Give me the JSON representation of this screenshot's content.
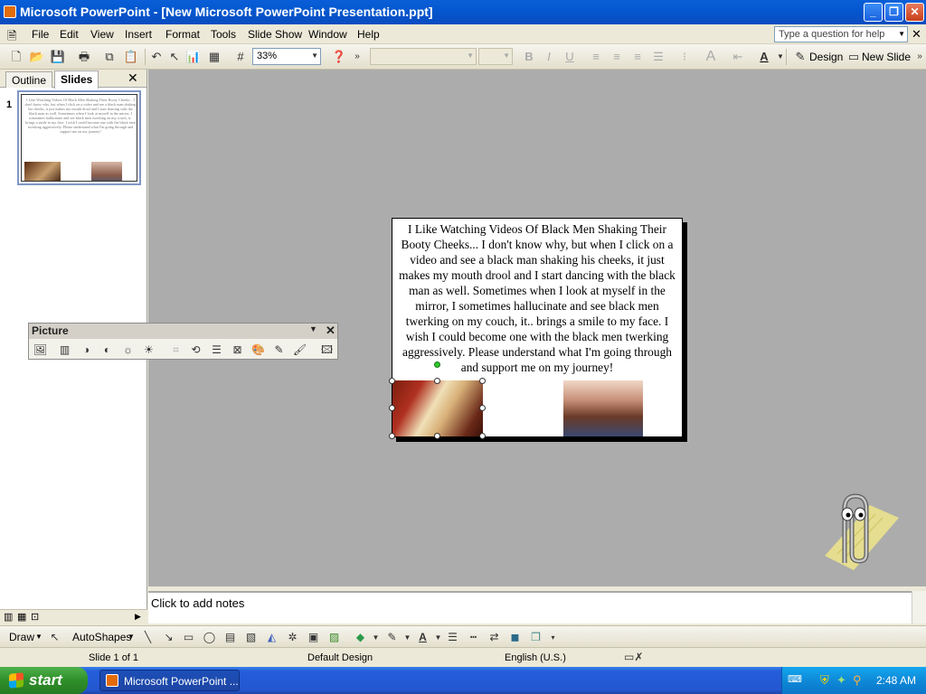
{
  "window": {
    "title": "Microsoft PowerPoint - [New Microsoft PowerPoint Presentation.ppt]"
  },
  "menu": {
    "items": [
      "File",
      "Edit",
      "View",
      "Insert",
      "Format",
      "Tools",
      "Slide Show",
      "Window",
      "Help"
    ],
    "help_placeholder": "Type a question for help"
  },
  "toolbar": {
    "zoom": "33%",
    "design_label": "Design",
    "new_slide_label": "New Slide",
    "bold": "B",
    "italic": "I",
    "underline": "U"
  },
  "left_pane": {
    "tabs": [
      "Outline",
      "Slides"
    ],
    "slide_number": "1"
  },
  "slide": {
    "text": "I Like Watching Videos Of Black Men Shaking Their Booty Cheeks... I don't know why, but when I click on a video and see a black man shaking his cheeks, it just makes my mouth drool and I start dancing with the black man as well. Sometimes when I look at myself in the mirror, I sometimes hallucinate and see black men twerking on my couch, it.. brings a smile to my face. I wish I could become one with the black men twerking aggressively. Please understand what I'm going through and support me on my journey!"
  },
  "picture_toolbar": {
    "title": "Picture"
  },
  "notes": {
    "placeholder": "Click to add notes"
  },
  "drawing": {
    "draw_label": "Draw",
    "autoshapes_label": "AutoShapes"
  },
  "status": {
    "slide": "Slide 1 of 1",
    "design": "Default Design",
    "language": "English (U.S.)"
  },
  "taskbar": {
    "start_label": "start",
    "task_item": "Microsoft PowerPoint ...",
    "clock": "2:48 AM"
  }
}
